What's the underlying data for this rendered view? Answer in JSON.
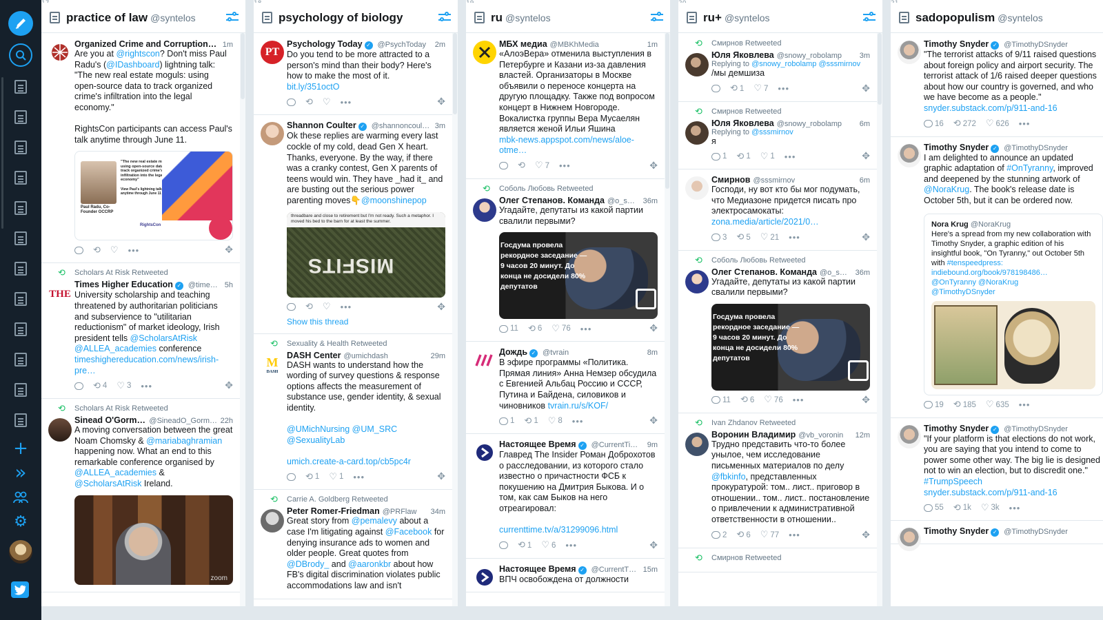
{
  "sidebar": {
    "compose_icon": "compose-icon",
    "search_icon": "search-icon",
    "columns_count": 12,
    "add_icon": "+",
    "expand_icon": "»",
    "accounts_icon": "accounts-icon",
    "settings_icon": "⚙",
    "twitter_icon": "twitter-bird-icon"
  },
  "columns": [
    {
      "number": "17",
      "title": "practice of law",
      "account": "@syntelos",
      "tweets": [
        {
          "name": "Organized Crime and Corruption…",
          "handle": "",
          "time": "1m",
          "text_a": "Are you at ",
          "link_a": "@rightscon",
          "text_b": "? Don't miss Paul Radu's (",
          "link_b": "@IDashboard",
          "text_c": ") lightning talk: \"The new real estate moguls: using open-source data to track organized crime's infiltration into the legal economy.\"\n\nRightsCon participants can access Paul's talk anytime through June 11.",
          "media_quote": "\"The new real estate moguls: using open-source data to track organized crime's infiltration into the legal economy\"",
          "media_sub": "View Paul's lightning talk anytime through June 11",
          "media_person": "Paul Radu, Co-Founder OCCRP",
          "media_brand": "RightsCon"
        },
        {
          "retweeted_by": "Scholars At Risk Retweeted",
          "name": "Times Higher Education",
          "handle": "@time…",
          "time": "5h",
          "avatar_text": "THE",
          "text": "University scholarship and teaching threatened by authoritarian politicians and subservience to \"utilitarian reductionism\" of market ideology, Irish president tells ",
          "links": [
            "@ScholarsAtRisk",
            "@ALLEA_academies",
            "timeshighereducation.com/news/irish-pre…"
          ],
          "text_mid": " conference ",
          "rt_count": "4",
          "like_count": "3"
        },
        {
          "retweeted_by": "Scholars At Risk Retweeted",
          "name": "Sinead O'Gorman",
          "handle": "@SineadO_Gorman",
          "time": "22h",
          "text_a": "A moving conversation between the great Noam Chomsky & ",
          "link_a": "@mariabaghramian",
          "text_b": " happening now. What an end to this remarkable conference organised by ",
          "link_b": "@ALLEA_academies",
          "text_c": " & ",
          "link_c": "@ScholarsAtRisk",
          "text_d": " Ireland.",
          "media_brand": "zoom"
        }
      ]
    },
    {
      "number": "18",
      "title": "psychology of biology",
      "account": "",
      "tweets": [
        {
          "name": "Psychology Today",
          "handle": "@PsychToday",
          "time": "2m",
          "avatar_text": "PT",
          "text": "Do you tend to be more attracted to a person's mind than their body? Here's how to make the most of it.",
          "link": "bit.ly/351octO"
        },
        {
          "name": "Shannon Coulter",
          "handle": "@shannoncoul…",
          "time": "3m",
          "text": "Ok these replies are warming every last cockle of my cold, dead Gen X heart. Thanks, everyone. By the way, if there was a cranky contest, Gen X parents of teens would win. They have _had it_ and are busting out the serious power parenting moves👇",
          "link": "@moonshinepop",
          "media_text": "threadbare and close to retirement but I'm not ready. Such a metaphor. I moved his bed to the barn for at least the summer.",
          "media_brand": "MISFITS",
          "show_thread": "Show this thread"
        },
        {
          "retweeted_by": "Sexuality & Health Retweeted",
          "name": "DASH Center",
          "handle": "@umichdash",
          "time": "29m",
          "avatar_text": "M",
          "avatar_sub": "DASH",
          "text": "DASH wants to understand how the wording of survey questions & response options affects the measurement of substance use, gender identity, & sexual identity.",
          "links": [
            "@UMichNursing",
            "@UM_SRC",
            "@SexualityLab",
            "umich.create-a-card.top/cb5pc4r"
          ],
          "rt_count": "1",
          "like_count": "1"
        },
        {
          "retweeted_by": "Carrie A. Goldberg Retweeted",
          "name": "Peter Romer-Friedman",
          "handle": "@PRFlaw",
          "time": "34m",
          "text_a": "Great story from ",
          "link_a": "@pemalevy",
          "text_b": " about a case I'm litigating against ",
          "link_b": "@Facebook",
          "text_c": " for denying insurance ads to women and older people. Great quotes from ",
          "link_c": "@DBrody_",
          "text_d": " and ",
          "link_d": "@aaronkbr",
          "text_e": " about how FB's digital discrimination violates public accommodations law and isn't"
        }
      ]
    },
    {
      "number": "19",
      "title": "ru",
      "account": "@syntelos",
      "tweets": [
        {
          "name": "МБХ медиа",
          "handle": "@MBKhMedia",
          "time": "1m",
          "text": "«АлоэВера» отменила выступления в Петербурге и Казани из-за давления властей. Организаторы в Москве объявили о переносе концерта на другую площадку. Также под вопросом концерт в Нижнем Новгороде. Вокалистка группы Вера Мусаелян является женой Ильи Яшина",
          "link": "mbk-news.appspot.com/news/aloe-otme…",
          "like_count": "7"
        },
        {
          "retweeted_by": "Соболь Любовь Retweeted",
          "name": "Олег Степанов. Команда",
          "handle": "@o_s…",
          "time": "36m",
          "text": "Угадайте, депутаты из какой партии свалили первыми?",
          "media_text": "Госдума провела рекордное заседание — 9 часов 20 минут. До конца не досидели 80% депутатов",
          "reply_count": "11",
          "rt_count": "6",
          "like_count": "76"
        },
        {
          "name": "Дождь",
          "handle": "@tvrain",
          "time": "8m",
          "text": "В эфире программы «Политика. Прямая линия» Анна Немзер обсудила с Евгенией Альбац Россию и СССР, Путина и Байдена, силовиков и чиновников ",
          "link": "tvrain.ru/s/KOF/",
          "reply_count": "1",
          "rt_count": "1",
          "like_count": "8"
        },
        {
          "name": "Настоящее Время",
          "handle": "@CurrentTi…",
          "time": "9m",
          "text": "Главред The Insider Роман Доброхотов о расследовании, из которого стало известно о причастности ФСБ к покушению на Дмитрия Быкова. И о том, как сам Быков на него отреагировал:",
          "link": "currenttime.tv/a/31299096.html",
          "rt_count": "1",
          "like_count": "6"
        },
        {
          "name": "Настоящее Время",
          "handle": "@CurrentT…",
          "time": "15m",
          "text": "ВПЧ освобождена от должности"
        }
      ]
    },
    {
      "number": "20",
      "title": "ru+",
      "account": "@syntelos",
      "tweets": [
        {
          "retweeted_by": "Смирнов Retweeted",
          "name": "Юля Яковлева",
          "handle": "@snowy_robolamp",
          "time": "3m",
          "reply_to_label": "Replying to ",
          "reply_to": "@snowy_robolamp @sssmirnov",
          "text": "/мы демшиза",
          "rt_count": "1",
          "like_count": "7"
        },
        {
          "retweeted_by": "Смирнов Retweeted",
          "name": "Юля Яковлева",
          "handle": "@snowy_robolamp",
          "time": "6m",
          "reply_to_label": "Replying to ",
          "reply_to": "@sssmirnov",
          "text": "я",
          "reply_count": "1",
          "rt_count": "1",
          "like_count": "1"
        },
        {
          "name": "Смирнов",
          "handle": "@sssmirnov",
          "time": "6m",
          "text": "Господи, ну вот кто бы мог подумать, что Медиазоне придется писать про электросамокаты:",
          "link": "zona.media/article/2021/0…",
          "reply_count": "3",
          "rt_count": "5",
          "like_count": "21"
        },
        {
          "retweeted_by": "Соболь Любовь Retweeted",
          "name": "Олег Степанов. Команда",
          "handle": "@o_s…",
          "time": "36m",
          "text": "Угадайте, депутаты из какой партии свалили первыми?",
          "media_text": "Госдума провела рекордное заседание — 9 часов 20 минут. До конца не досидели 80% депутатов",
          "reply_count": "11",
          "rt_count": "6",
          "like_count": "76"
        },
        {
          "retweeted_by": "Ivan Zhdanov Retweeted",
          "name": "Воронин Владимир",
          "handle": "@vb_voronin",
          "time": "12m",
          "text_a": "Трудно представить что-то более унылое, чем исследование письменных материалов по делу ",
          "link_a": "@fbkinfo",
          "text_b": ", представленных прокуратурой: том.. лист.. приговор в отношении.. том.. лист.. постановление о привлечении к административной ответственности в отношении..",
          "reply_count": "2",
          "rt_count": "6",
          "like_count": "77"
        },
        {
          "retweeted_by": "Смирнов Retweeted",
          "name": "",
          "handle": "",
          "time": "",
          "text": ""
        }
      ]
    },
    {
      "number": "21",
      "title": "sadopopulism",
      "account": "@syntelos",
      "tweets": [
        {
          "name": "Timothy Snyder",
          "handle": "@TimothyDSnyder",
          "time": "",
          "text": "\"The terrorist attacks of 9/11 raised questions about foreign policy and airport security. The terrorist attack of 1/6 raised deeper questions about how our country is governed, and who we have become as a people.\"",
          "link": "snyder.substack.com/p/911-and-16",
          "reply_count": "16",
          "rt_count": "272",
          "like_count": "626"
        },
        {
          "name": "Timothy Snyder",
          "handle": "@TimothyDSnyder",
          "time": "",
          "text_a": "I am delighted to announce an updated graphic adaptation of ",
          "link_a": "#OnTyranny",
          "text_b": ", improved and deepened by the stunning artwork of ",
          "link_b": "@NoraKrug",
          "text_c": ". The book's release date is October 5th, but it can be ordered now.",
          "quote_name": "Nora Krug",
          "quote_handle": "@NoraKrug",
          "quote_text": "Here's a spread from my new collaboration with Timothy Snyder, a graphic edition of his insightful book, \"On Tyranny,\" out October 5th with ",
          "quote_links": [
            "#tenspeedpress:",
            "indiebound.org/book/978198486…",
            "@OnTyranny @NoraKrug",
            "@TimothyDSnyder"
          ],
          "reply_count": "19",
          "rt_count": "185",
          "like_count": "635"
        },
        {
          "name": "Timothy Snyder",
          "handle": "@TimothyDSnyder",
          "time": "",
          "text": "\"If your platform is that elections do not work, you are saying that you intend to come to power some other way. The big lie is designed not to win an election, but to discredit one.\"",
          "links": [
            "#TrumpSpeech",
            "snyder.substack.com/p/911-and-16"
          ],
          "reply_count": "55",
          "rt_count": "1k",
          "like_count": "3k"
        },
        {
          "name": "Timothy Snyder",
          "handle": "@TimothyDSnyder",
          "time": "",
          "text": ""
        }
      ]
    }
  ],
  "colors": {
    "accent": "#1da1f2",
    "sidebar_bg": "#15202b",
    "retweet": "#17bf63",
    "muted": "#657786"
  }
}
